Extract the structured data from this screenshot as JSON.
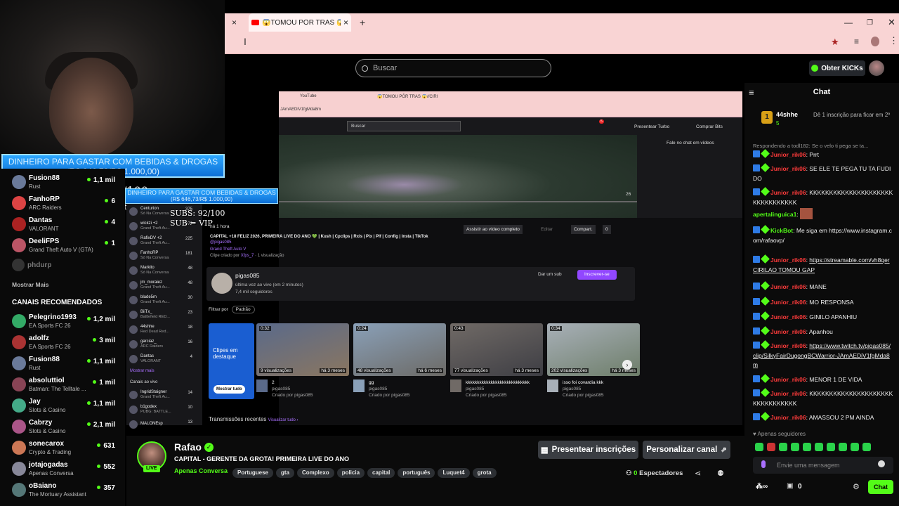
{
  "browser": {
    "tab_title": "😱TOMOU PÔR TRAS 😱//CIRI",
    "tab_close": "×",
    "new_tab": "+"
  },
  "overlay": {
    "goal_title": "DINHEIRO PARA GASTAR COM BEBIDAS & DROGAS",
    "goal_amount": "(R$ 646,73/R$ 1.000,00)",
    "subs": "SUBS: 92/100",
    "sub_vip": "SUB = VIP"
  },
  "kick": {
    "search_placeholder": "Buscar",
    "get_kicks": "Obter KICKs"
  },
  "sidebar": {
    "channels_top": [
      {
        "name": "Fusion88",
        "game": "Rust",
        "viewers": "1,1 mil",
        "color": "#6a7a9a"
      },
      {
        "name": "FanhoRP",
        "game": "ARC Raiders",
        "viewers": "6",
        "color": "#d44"
      },
      {
        "name": "Dantas",
        "game": "VALORANT",
        "viewers": "4",
        "color": "#a22"
      },
      {
        "name": "DeeliFPS",
        "game": "Grand Theft Auto V (GTA)",
        "viewers": "1",
        "color": "#b56"
      }
    ],
    "offline": "phdurp",
    "show_more": "Mostrar Mais",
    "recommended_title": "CANAIS RECOMENDADOS",
    "recommended": [
      {
        "name": "Pelegrino1993",
        "game": "EA Sports FC 26",
        "viewers": "1,2 mil",
        "color": "#3a6"
      },
      {
        "name": "adolfz",
        "game": "EA Sports FC 26",
        "viewers": "3 mil",
        "color": "#a33"
      },
      {
        "name": "Fusion88",
        "game": "Rust",
        "viewers": "1,1 mil",
        "color": "#6a7a9a"
      },
      {
        "name": "absoluttiol",
        "game": "Batman: The Telltale ...",
        "viewers": "1 mil",
        "color": "#845"
      },
      {
        "name": "Jay",
        "game": "Slots & Casino",
        "viewers": "1,1 mil",
        "color": "#4a8"
      },
      {
        "name": "Cabrzy",
        "game": "Slots & Casino",
        "viewers": "2,1 mil",
        "color": "#a58"
      },
      {
        "name": "sonecarox",
        "game": "Crypto & Trading",
        "viewers": "631",
        "color": "#c75"
      },
      {
        "name": "jotajogadas",
        "game": "Apenas Conversa",
        "viewers": "552",
        "color": "#889"
      },
      {
        "name": "oBaiano",
        "game": "The Mortuary Assistant",
        "viewers": "357",
        "color": "#577"
      }
    ]
  },
  "inner": {
    "tab1": "YouTube",
    "tab2": "😱TOMOU PÔR TRAS 😱//CIRI",
    "url": "JAmAEDiV1fgMda8m",
    "search": "Buscar",
    "present_turbo": "Presentear Turbo",
    "buy_bits": "Comprar Bits",
    "notif": "5",
    "chat_link": "Fale no chat em vídeos",
    "time": "26",
    "ago": "há 1 hora",
    "title": "CAPITAL +18 FELIZ 2026, PRIMEIRA LIVE DO ANO 💚 | Kush | Cpclips | Rxis | Pix | Plf | Config | Insta | TikTok",
    "handle": "@pigas085",
    "game": "Grand Theft Auto V",
    "clip_by": "Clipe criado por",
    "clip_user": "Xfps_7",
    "views": "1 visualização",
    "watch_full": "Assistir ao vídeo completo",
    "edit": "Editar",
    "share": "Compart.",
    "likes": "0",
    "channel": "pigas085",
    "last_live": "última vez ao vivo (em 2 minutos)",
    "followers": "7,4 mil seguidores",
    "gift_sub": "Dar um sub",
    "subscribe": "Inscrever-se",
    "filter": "Filtrar por",
    "filter_val": "Padrão",
    "featured": "Clipes em destaque",
    "show_all": "Mostrar tudo",
    "recent": "Transmissões recentes",
    "view_all": "Visualizar tudo ›",
    "clips": [
      {
        "dur": "0:32",
        "views": "9 visualizações",
        "age": "há 3 meses",
        "title": "2",
        "ch": "pigas085",
        "by": "Criado por pigas085",
        "c1": "#5a6a8a",
        "c2": "#8a7660"
      },
      {
        "dur": "0:24",
        "views": "48 visualizações",
        "age": "há 6 meses",
        "title": "gg",
        "ch": "pigas085",
        "by": "Criado por pigas085",
        "c1": "#8aa0b8",
        "c2": "#6c6a66"
      },
      {
        "dur": "0:43",
        "views": "77 visualizações",
        "age": "há 3 meses",
        "title": "kkkkkkkkkkkkkkkkkkkkkkkkkkkk",
        "ch": "pigas085",
        "by": "Criado por pigas085",
        "c1": "#706a66",
        "c2": "#3e3e44"
      },
      {
        "dur": "0:34",
        "views": "202 visualizações",
        "age": "há 3 meses",
        "title": "isso foi covardia kkk",
        "ch": "pigas085",
        "by": "Criado por pigas085",
        "c1": "#a8b0b8",
        "c2": "#6e7e6a"
      }
    ],
    "side_items": [
      {
        "n": "Centurion",
        "g": "Só Na Conversa",
        "v": "375"
      },
      {
        "n": "wickzi +2",
        "g": "Grand Theft Au...",
        "v": "272"
      },
      {
        "n": "RafixDV +2",
        "g": "Grand Theft Au...",
        "v": "225"
      },
      {
        "n": "FanhoRP",
        "g": "Só Na Conversa",
        "v": "181"
      },
      {
        "n": "Markito",
        "g": "Só Na Conversa",
        "v": "48"
      },
      {
        "n": "jm_moraiez",
        "g": "Grand Theft Au...",
        "v": "48"
      },
      {
        "n": "blade5m",
        "g": "Grand Theft Au...",
        "v": "30"
      },
      {
        "n": "BiiTx_",
        "g": "Battlefield RED...",
        "v": "23"
      },
      {
        "n": "44shhe",
        "g": "Red Dead Red...",
        "v": "18"
      },
      {
        "n": "garciaz_",
        "g": "ARC Raiders",
        "v": "16"
      },
      {
        "n": "Dantas",
        "g": "VALORANT",
        "v": "4"
      }
    ],
    "side_more": "Mostrar mais",
    "side_live": "Canais ao vivo",
    "side_live_items": [
      {
        "n": "IngridStaigner",
        "g": "Grand Theft Au...",
        "v": "14"
      },
      {
        "n": "b1godex",
        "g": "PUBG: BATTLE...",
        "v": "10"
      },
      {
        "n": "MALONEsp",
        "g": "",
        "v": "13"
      }
    ]
  },
  "stream": {
    "name": "Rafao",
    "live": "LIVE",
    "title": "CAPITAL - GERENTE DA GROTA! PRIMEIRA LIVE DO ANO",
    "category": "Apenas Conversa",
    "tags": [
      "Portuguese",
      "gta",
      "Complexo",
      "policia",
      "capital",
      "português",
      "Luquet4",
      "grota"
    ],
    "gift_subs": "Presentear inscrições",
    "customize": "Personalizar canal",
    "viewers": "0",
    "viewers_label": "Espectadores"
  },
  "chat": {
    "title": "Chat",
    "pin_user": "44shhe",
    "pin_count": "5",
    "pin_cta": "Dê 1 inscrição para ficar em 2º",
    "reply_to": "Respondendo a todl182: Se o velo ti pega se ta...",
    "messages": [
      {
        "user": "Junior_rik06",
        "text": "Prrt"
      },
      {
        "user": "Junior_rik06",
        "text": "SE ELE TE PEGA TU TA FUDIDO"
      },
      {
        "user": "Junior_rik06",
        "text": "KKKKKKKKKKKKKKKKKKKKKKKKKKKKKKKK"
      },
      {
        "user": "apertalinguica1",
        "text": ""
      },
      {
        "user": "KickBot",
        "text": "Me siga em https://www.instagram.com/rafaovp/"
      },
      {
        "user": "Junior_rik06",
        "text": "https://streamable.com/vh8qer CIRILAO TOMOU GAP"
      },
      {
        "user": "Junior_rik06",
        "text": "MANE"
      },
      {
        "user": "Junior_rik06",
        "text": "MO RESPONSA"
      },
      {
        "user": "Junior_rik06",
        "text": "GINILO APANHIU"
      },
      {
        "user": "Junior_rik06",
        "text": "Apanhou"
      },
      {
        "user": "Junior_rik06",
        "text": "https://www.twitch.tv/pigas085/clip/SilkyFairDugongBCWarrior-JAmAEDiV1fgMda8m"
      },
      {
        "user": "Junior_rik06",
        "text": "MENOR 1 DE VIDA"
      },
      {
        "user": "Junior_rik06",
        "text": "KKKKKKKKKKKKKKKKKKKKKKKKKKKKKKKK"
      },
      {
        "user": "Junior_rik06",
        "text": "AMASSOU 2 PM AINDA"
      }
    ],
    "followers_only": "Apenas seguidores",
    "input_placeholder": "Envie uma mensagem",
    "points": "0",
    "send": "Chat"
  }
}
